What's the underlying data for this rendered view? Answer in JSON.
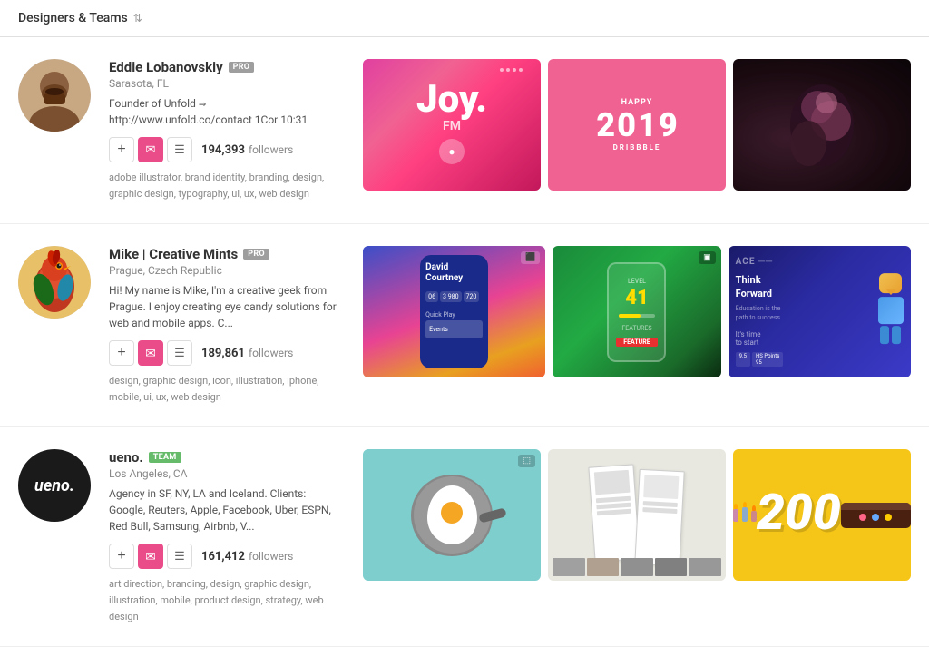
{
  "header": {
    "title": "Designers & Teams",
    "sort_icon": "⇅"
  },
  "designers": [
    {
      "id": "eddie",
      "name": "Eddie Lobanovskiy",
      "badge": "PRO",
      "badge_type": "pro",
      "location": "Sarasota, FL",
      "description": "Founder of Unfold ⇒\nhttp://www.unfold.co/contact 1Cor 10:31",
      "followers_count": "194,393",
      "followers_label": "followers",
      "tags": "adobe illustrator, brand identity, branding, design, graphic design, typography, ui, ux, web design",
      "portfolio": [
        {
          "id": "joy",
          "type": "joy"
        },
        {
          "id": "happy2019",
          "type": "happy2019"
        },
        {
          "id": "dark-figure",
          "type": "dark"
        }
      ]
    },
    {
      "id": "mike",
      "name": "Mike | Creative Mints",
      "badge": "PRO",
      "badge_type": "pro",
      "location": "Prague, Czech Republic",
      "description": "Hi! My name is Mike, I'm a creative geek from Prague. I enjoy creating eye candy solutions for web and mobile apps. C...",
      "followers_count": "189,861",
      "followers_label": "followers",
      "tags": "design, graphic design, icon, illustration, iphone, mobile, ui, ux, web design",
      "portfolio": [
        {
          "id": "david-courtney",
          "type": "david"
        },
        {
          "id": "golf",
          "type": "golf"
        },
        {
          "id": "ace",
          "type": "ace"
        }
      ]
    },
    {
      "id": "ueno",
      "name": "ueno.",
      "badge": "TEAM",
      "badge_type": "team",
      "location": "Los Angeles, CA",
      "description": "Agency in SF, NY, LA and Iceland. Clients: Google, Reuters, Apple, Facebook, Uber, ESPN, Red Bull, Samsung, Airbnb, V...",
      "followers_count": "161,412",
      "followers_label": "followers",
      "tags": "art direction, branding, design, graphic design, illustration, mobile, product design, strategy, web design",
      "portfolio": [
        {
          "id": "egg",
          "type": "egg"
        },
        {
          "id": "brochure",
          "type": "brochure"
        },
        {
          "id": "200-cake",
          "type": "cake200"
        }
      ]
    }
  ],
  "buttons": {
    "add": "+",
    "message": "✉",
    "list": "☰"
  }
}
